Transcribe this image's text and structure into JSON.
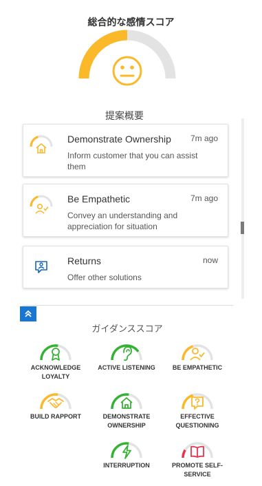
{
  "score": {
    "title": "総合的な感情スコア",
    "value_fraction": 0.5,
    "color": "#fbb829",
    "face": "neutral-face-icon"
  },
  "summary": {
    "title": "提案概要",
    "cards": [
      {
        "title": "Demonstrate Ownership",
        "time": "7m ago",
        "description": "Inform customer that you can assist them",
        "icon": "home-icon",
        "level": 0.4
      },
      {
        "title": "Be Empathetic",
        "time": "7m ago",
        "description": "Convey an understanding and appreciation for situation",
        "icon": "person-check-icon",
        "level": 0.4
      },
      {
        "title": "Returns",
        "time": "now",
        "description": "Offer other solutions",
        "icon": "chat-person-icon"
      }
    ]
  },
  "guidance": {
    "title": "ガイダンススコア",
    "items": [
      {
        "label": "ACKNOWLEDGE LOYALTY",
        "icon": "award-icon",
        "color": "#34b233",
        "level": 0.55
      },
      {
        "label": "ACTIVE LISTENING",
        "icon": "ear-icon",
        "color": "#34b233",
        "level": 0.8
      },
      {
        "label": "BE EMPATHETIC",
        "icon": "person-check-icon",
        "color": "#fbb829",
        "level": 0.4
      },
      {
        "label": "BUILD RAPPORT",
        "icon": "handshake-icon",
        "color": "#fbb829",
        "level": 0.55
      },
      {
        "label": "DEMONSTRATE OWNERSHIP",
        "icon": "home-icon",
        "color": "#34b233",
        "level": 0.55
      },
      {
        "label": "EFFECTIVE QUESTIONING",
        "icon": "question-chat-icon",
        "color": "#fbb829",
        "level": 0.4
      },
      {
        "label": "INTERRUPTION",
        "icon": "lightning-icon",
        "color": "#34b233",
        "level": 0.55
      },
      {
        "label": "PROMOTE SELF-SERVICE",
        "icon": "book-icon",
        "color": "#e8344e",
        "level": 0.18
      }
    ]
  }
}
